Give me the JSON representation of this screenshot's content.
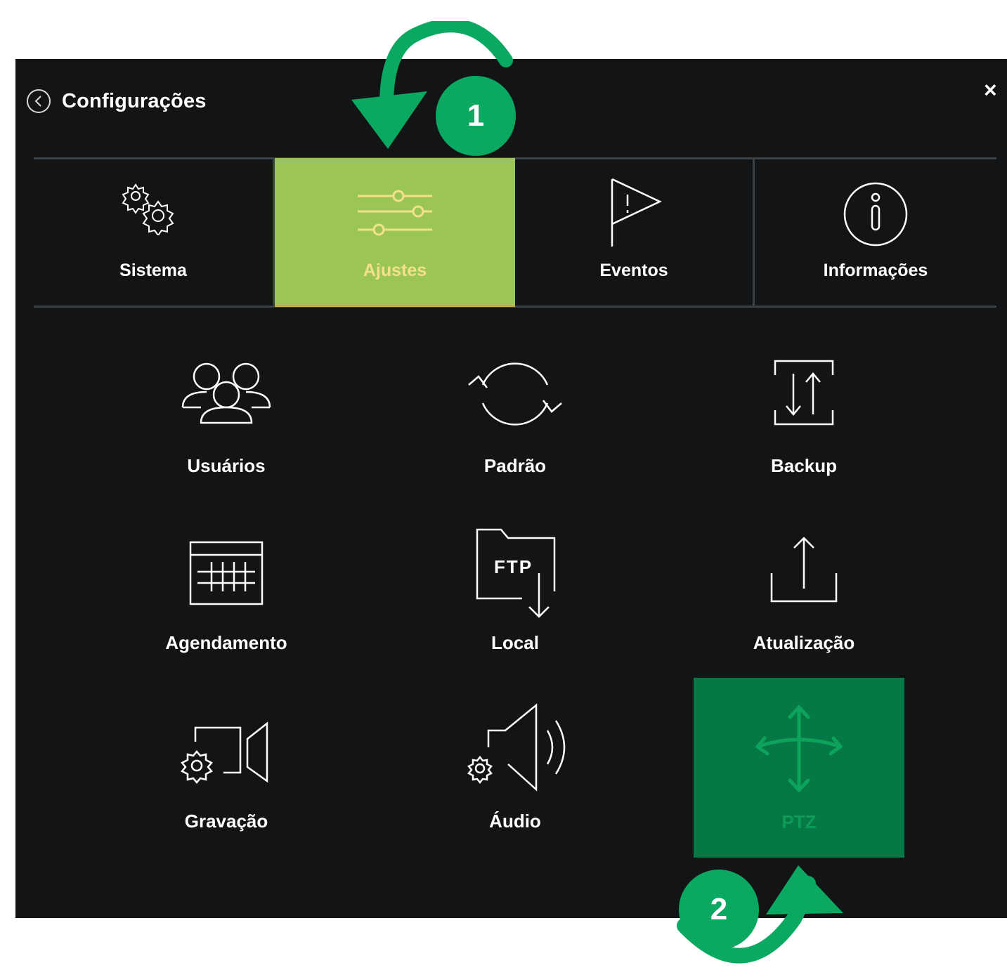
{
  "header": {
    "title": "Configurações",
    "close_glyph": "×"
  },
  "tabs": [
    {
      "label": "Sistema",
      "icon": "gears-icon"
    },
    {
      "label": "Ajustes",
      "icon": "sliders-icon",
      "active": true
    },
    {
      "label": "Eventos",
      "icon": "flag-icon"
    },
    {
      "label": "Informações",
      "icon": "info-icon"
    }
  ],
  "grid": [
    {
      "label": "Usuários",
      "icon": "users-icon"
    },
    {
      "label": "Padrão",
      "icon": "refresh-icon"
    },
    {
      "label": "Backup",
      "icon": "backup-icon"
    },
    {
      "label": "Agendamento",
      "icon": "calendar-icon"
    },
    {
      "label": "Local",
      "icon": "ftp-folder-icon"
    },
    {
      "label": "Atualização",
      "icon": "upload-icon"
    },
    {
      "label": "Gravação",
      "icon": "camera-gear-icon"
    },
    {
      "label": "Áudio",
      "icon": "speaker-icon"
    },
    {
      "label": "PTZ",
      "icon": "move-arrows-icon",
      "highlighted": true
    }
  ],
  "callouts": [
    {
      "label": "1"
    },
    {
      "label": "2"
    }
  ],
  "colors": {
    "panel": "#121415",
    "active_tab": "#9bc555",
    "active_tab_text": "#f3e28a",
    "ptz_bg": "#067845",
    "callout": "#0ba862"
  }
}
